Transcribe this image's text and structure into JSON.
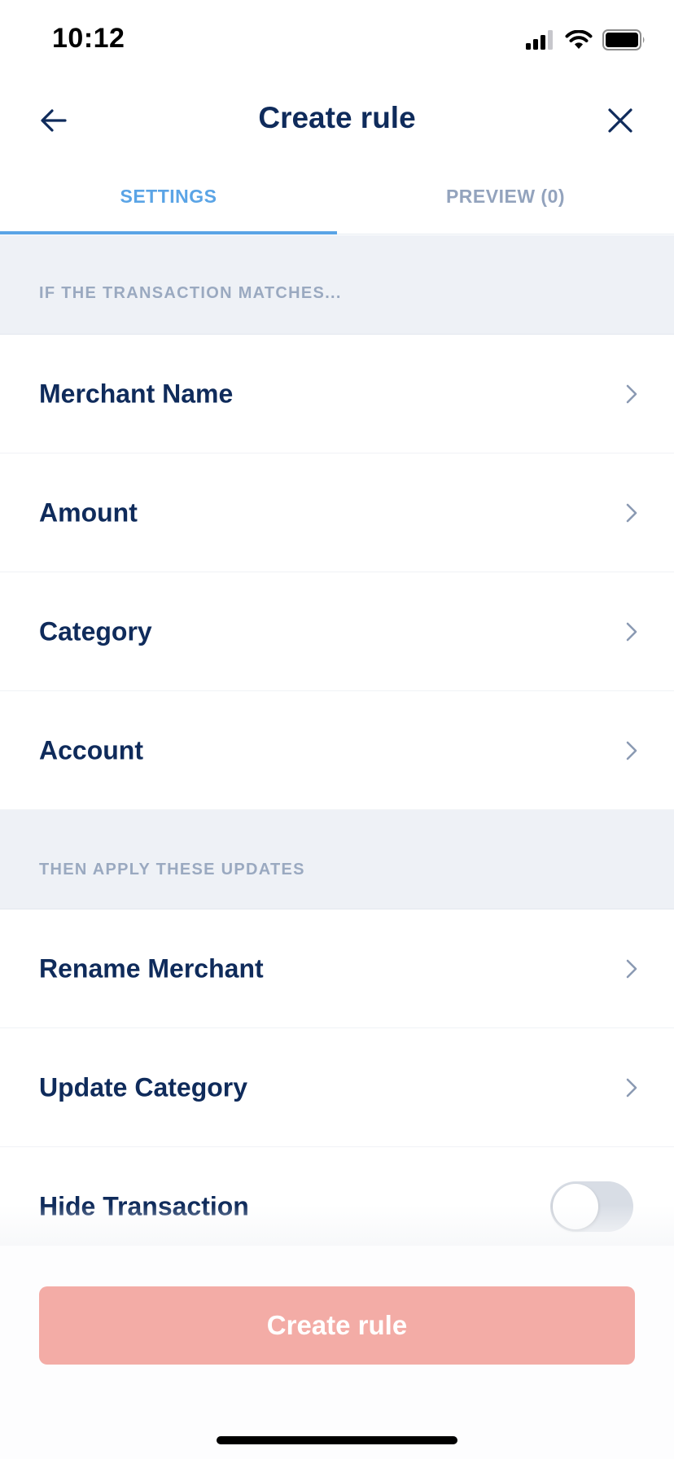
{
  "status_bar": {
    "time": "10:12"
  },
  "nav": {
    "title": "Create rule",
    "back_icon": "arrow-left-icon",
    "close_icon": "close-icon"
  },
  "tabs": [
    {
      "label": "SETTINGS",
      "active": true
    },
    {
      "label": "PREVIEW (0)",
      "active": false
    }
  ],
  "conditions_section": {
    "header": "IF THE TRANSACTION MATCHES...",
    "items": [
      {
        "label": "Merchant Name"
      },
      {
        "label": "Amount"
      },
      {
        "label": "Category"
      },
      {
        "label": "Account"
      }
    ]
  },
  "actions_section": {
    "header": "THEN APPLY THESE UPDATES",
    "items": [
      {
        "label": "Rename Merchant"
      },
      {
        "label": "Update Category"
      }
    ],
    "toggle_item": {
      "label": "Hide Transaction",
      "checked": false
    }
  },
  "footer": {
    "create_button_label": "Create rule"
  },
  "colors": {
    "primary_text": "#0f2b5b",
    "accent": "#5aa4e6",
    "section_bg": "#eef1f6",
    "button_disabled": "#f3aca6"
  }
}
